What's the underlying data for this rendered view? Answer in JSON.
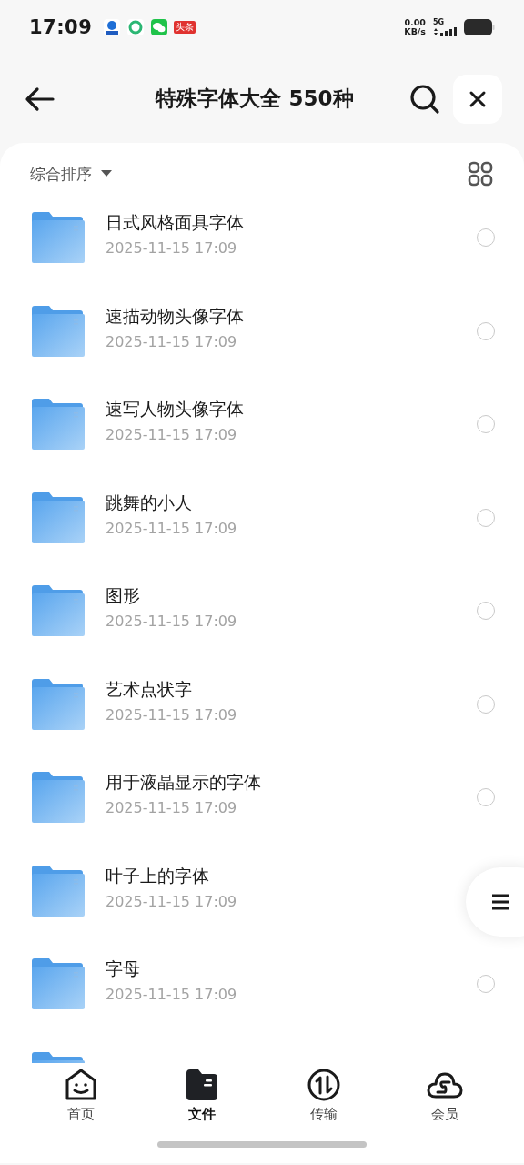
{
  "status_bar": {
    "time": "17:09",
    "net_speed": "0.00",
    "net_unit": "KB/s",
    "network": "5G",
    "badge": "头条"
  },
  "header": {
    "title": "特殊字体大全 550种"
  },
  "sort": {
    "label": "综合排序"
  },
  "files": [
    {
      "kind": "folder",
      "name": "日式风格面具字体",
      "date": "2025-11-15 17:09",
      "selected": false
    },
    {
      "kind": "folder",
      "name": "速描动物头像字体",
      "date": "2025-11-15 17:09",
      "selected": false
    },
    {
      "kind": "folder",
      "name": "速写人物头像字体",
      "date": "2025-11-15 17:09",
      "selected": false
    },
    {
      "kind": "folder",
      "name": "跳舞的小人",
      "date": "2025-11-15 17:09",
      "selected": false
    },
    {
      "kind": "folder",
      "name": "图形",
      "date": "2025-11-15 17:09",
      "selected": false
    },
    {
      "kind": "folder",
      "name": "艺术点状字",
      "date": "2025-11-15 17:09",
      "selected": false
    },
    {
      "kind": "folder",
      "name": "用于液晶显示的字体",
      "date": "2025-11-15 17:09",
      "selected": false
    },
    {
      "kind": "folder",
      "name": "叶子上的字体",
      "date": "2025-11-15 17:09"
    },
    {
      "kind": "folder",
      "name": "字母",
      "date": "2025-11-15 17:09",
      "selected": false
    },
    {
      "kind": "clipped"
    }
  ],
  "nav": [
    {
      "kind": "home",
      "label": "首页",
      "selected": false
    },
    {
      "kind": "files",
      "label": "文件",
      "selected": true
    },
    {
      "kind": "transfer",
      "label": "传输",
      "selected": false
    },
    {
      "kind": "vip",
      "label": "会员",
      "selected": false
    }
  ]
}
